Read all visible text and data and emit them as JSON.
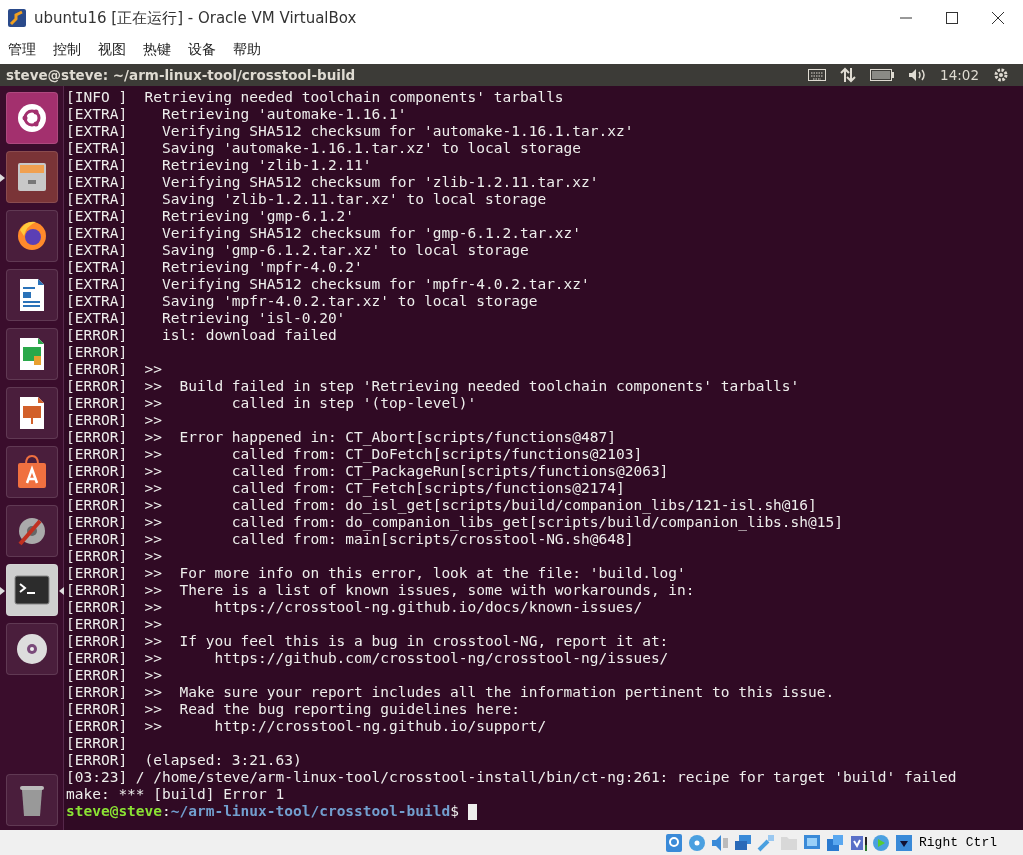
{
  "window": {
    "title": "ubuntu16 [正在运行] - Oracle VM VirtualBox"
  },
  "menu": [
    "管理",
    "控制",
    "视图",
    "热键",
    "设备",
    "帮助"
  ],
  "top_panel": {
    "title": "steve@steve: ~/arm-linux-tool/crosstool-build",
    "clock": "14:02"
  },
  "launcher": [
    {
      "kind": "ubuntu",
      "running": false,
      "selected": false
    },
    {
      "kind": "files",
      "running": true,
      "selected": false
    },
    {
      "kind": "firefox",
      "running": false,
      "selected": false
    },
    {
      "kind": "writer",
      "running": false,
      "selected": false
    },
    {
      "kind": "calc",
      "running": false,
      "selected": false
    },
    {
      "kind": "impress",
      "running": false,
      "selected": false
    },
    {
      "kind": "software",
      "running": false,
      "selected": false
    },
    {
      "kind": "settings",
      "running": false,
      "selected": false
    },
    {
      "kind": "terminal",
      "running": true,
      "selected": true
    },
    {
      "kind": "dvd",
      "running": false,
      "selected": false
    },
    {
      "kind": "trash",
      "running": false,
      "selected": false
    }
  ],
  "terminal": {
    "lines": [
      "[INFO ]  Retrieving needed toolchain components' tarballs",
      "[EXTRA]    Retrieving 'automake-1.16.1'",
      "[EXTRA]    Verifying SHA512 checksum for 'automake-1.16.1.tar.xz'",
      "[EXTRA]    Saving 'automake-1.16.1.tar.xz' to local storage",
      "[EXTRA]    Retrieving 'zlib-1.2.11'",
      "[EXTRA]    Verifying SHA512 checksum for 'zlib-1.2.11.tar.xz'",
      "[EXTRA]    Saving 'zlib-1.2.11.tar.xz' to local storage",
      "[EXTRA]    Retrieving 'gmp-6.1.2'",
      "[EXTRA]    Verifying SHA512 checksum for 'gmp-6.1.2.tar.xz'",
      "[EXTRA]    Saving 'gmp-6.1.2.tar.xz' to local storage",
      "[EXTRA]    Retrieving 'mpfr-4.0.2'",
      "[EXTRA]    Verifying SHA512 checksum for 'mpfr-4.0.2.tar.xz'",
      "[EXTRA]    Saving 'mpfr-4.0.2.tar.xz' to local storage",
      "[EXTRA]    Retrieving 'isl-0.20'",
      "[ERROR]    isl: download failed",
      "[ERROR]",
      "[ERROR]  >>",
      "[ERROR]  >>  Build failed in step 'Retrieving needed toolchain components' tarballs'",
      "[ERROR]  >>        called in step '(top-level)'",
      "[ERROR]  >>",
      "[ERROR]  >>  Error happened in: CT_Abort[scripts/functions@487]",
      "[ERROR]  >>        called from: CT_DoFetch[scripts/functions@2103]",
      "[ERROR]  >>        called from: CT_PackageRun[scripts/functions@2063]",
      "[ERROR]  >>        called from: CT_Fetch[scripts/functions@2174]",
      "[ERROR]  >>        called from: do_isl_get[scripts/build/companion_libs/121-isl.sh@16]",
      "[ERROR]  >>        called from: do_companion_libs_get[scripts/build/companion_libs.sh@15]",
      "[ERROR]  >>        called from: main[scripts/crosstool-NG.sh@648]",
      "[ERROR]  >>",
      "[ERROR]  >>  For more info on this error, look at the file: 'build.log'",
      "[ERROR]  >>  There is a list of known issues, some with workarounds, in:",
      "[ERROR]  >>      https://crosstool-ng.github.io/docs/known-issues/",
      "[ERROR]  >>",
      "[ERROR]  >>  If you feel this is a bug in crosstool-NG, report it at:",
      "[ERROR]  >>      https://github.com/crosstool-ng/crosstool-ng/issues/",
      "[ERROR]  >>",
      "[ERROR]  >>  Make sure your report includes all the information pertinent to this issue.",
      "[ERROR]  >>  Read the bug reporting guidelines here:",
      "[ERROR]  >>      http://crosstool-ng.github.io/support/",
      "[ERROR]",
      "[ERROR]  (elapsed: 3:21.63)",
      "[03:23] / /home/steve/arm-linux-tool/crosstool-install/bin/ct-ng:261: recipe for target 'build' failed",
      "make: *** [build] Error 1"
    ],
    "prompt": {
      "user": "steve@steve",
      "separator": ":",
      "path": "~/arm-linux-tool/crosstool-build",
      "symbol": "$"
    }
  },
  "status_bar": {
    "host_key": "Right Ctrl"
  }
}
